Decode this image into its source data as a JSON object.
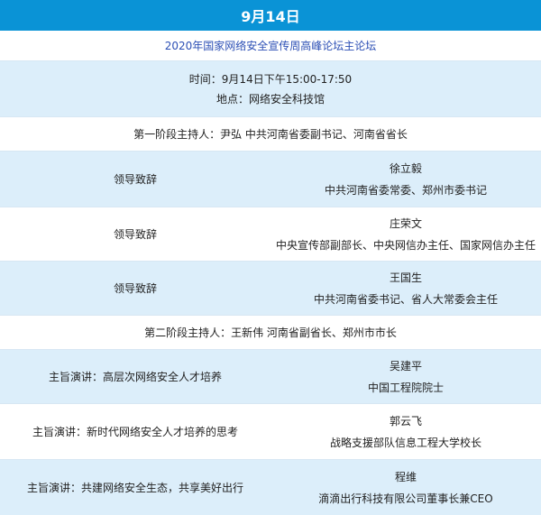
{
  "header": {
    "date": "9月14日"
  },
  "forum_title": "2020年国家网络安全宣传周高峰论坛主论坛",
  "info": {
    "time": "时间：9月14日下午15:00-17:50",
    "location": "地点：网络安全科技馆"
  },
  "stage1_host": "第一阶段主持人：尹弘 中共河南省委副书记、河南省省长",
  "stage2_host": "第二阶段主持人：王新伟 河南省副省长、郑州市市长",
  "agenda_a": [
    {
      "item": "领导致辞",
      "name": "徐立毅",
      "title": "中共河南省委常委、郑州市委书记"
    },
    {
      "item": "领导致辞",
      "name": "庄荣文",
      "title": "中央宣传部副部长、中央网信办主任、国家网信办主任"
    },
    {
      "item": "领导致辞",
      "name": "王国生",
      "title": "中共河南省委书记、省人大常委会主任"
    }
  ],
  "agenda_b": [
    {
      "item": "主旨演讲：高层次网络安全人才培养",
      "name": "吴建平",
      "title": "中国工程院院士"
    },
    {
      "item": "主旨演讲：新时代网络安全人才培养的思考",
      "name": "郭云飞",
      "title": "战略支援部队信息工程大学校长"
    },
    {
      "item": "主旨演讲：共建网络安全生态，共享美好出行",
      "name": "程维",
      "title": "滴滴出行科技有限公司董事长兼CEO"
    }
  ]
}
